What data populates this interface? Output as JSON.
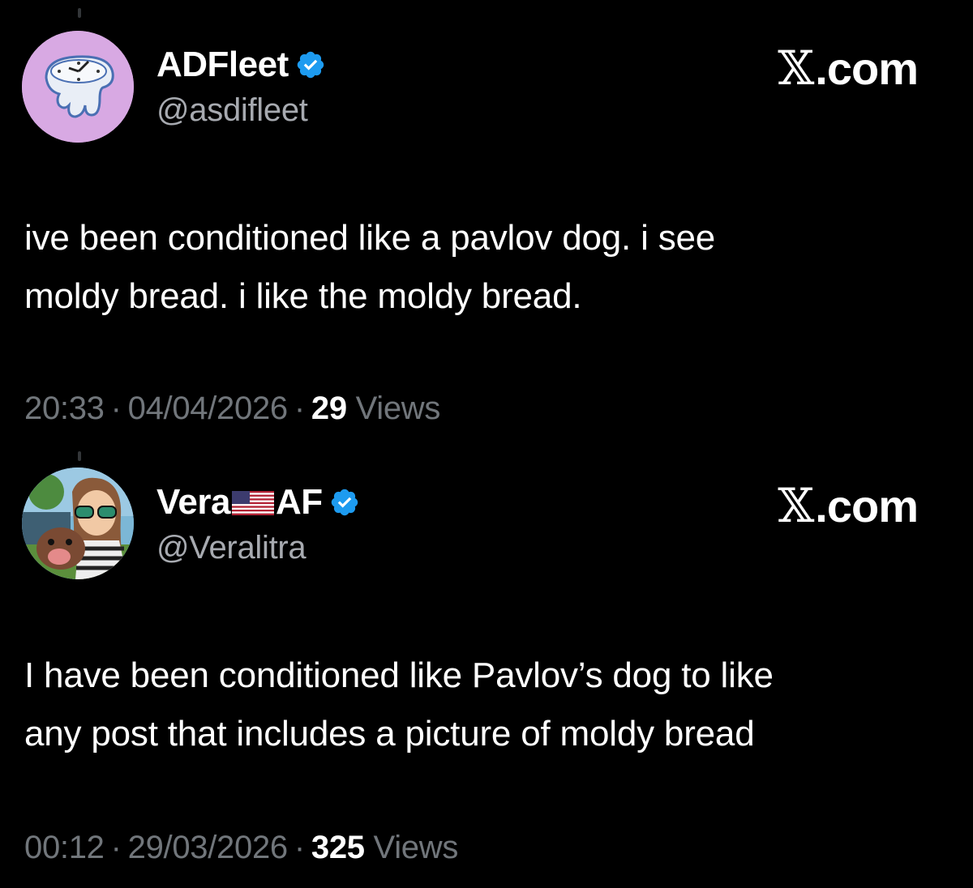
{
  "tweets": [
    {
      "display_name": "ADFleet",
      "handle": "@asdifleet",
      "brand": ".com",
      "brand_x": "𝕏",
      "text_line1": "ive been conditioned like a pavlov dog. i see",
      "text_line2": "moldy bread. i like the moldy bread.",
      "time": "20:33",
      "date": "04/04/2026",
      "views_count": "29",
      "views_label": "Views",
      "separator": "·",
      "verified_color": "#1d9bf0"
    },
    {
      "display_name_part1": "Vera",
      "display_name_part2": "AF",
      "handle": "@Veralitra",
      "brand": ".com",
      "brand_x": "𝕏",
      "text_line1": "I have been conditioned like Pavlov’s dog to like",
      "text_line2": "any post that includes a picture of moldy bread",
      "time": "00:12",
      "date": "29/03/2026",
      "views_count": "325",
      "views_label": "Views",
      "separator": "·",
      "verified_color": "#1d9bf0"
    }
  ],
  "colors": {
    "background": "#000000",
    "text": "#ffffff",
    "secondary_text": "#71767b",
    "verified": "#1d9bf0"
  }
}
